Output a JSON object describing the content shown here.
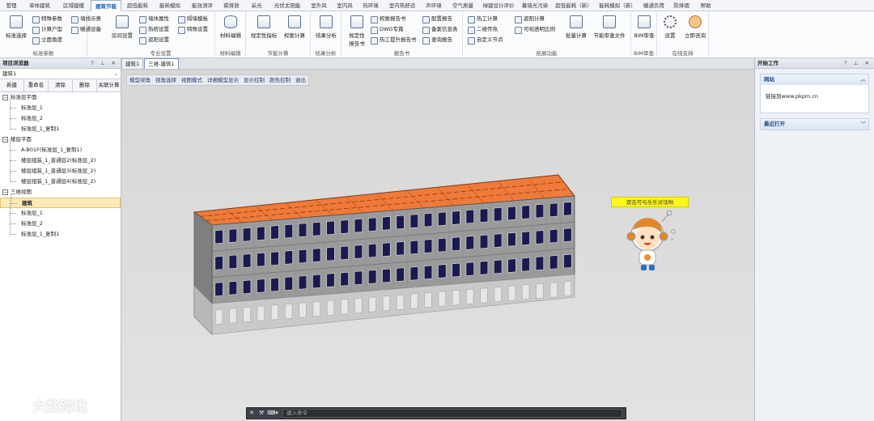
{
  "menu_tabs": [
    "管理",
    "单体建筑",
    "区域建模",
    "建筑节能",
    "超低能耗",
    "能耗模拟",
    "能效测评",
    "碳排放",
    "采光",
    "光伏太阳能",
    "室外风",
    "室内风",
    "热环境",
    "室内热舒适",
    "声环境",
    "空气质量",
    "绿建设计评价",
    "幕墙光污染",
    "超低能耗（新）",
    "能耗模拟（新）",
    "暖通负荷",
    "防排烟",
    "帮助"
  ],
  "active_menu_tab": "建筑节能",
  "ribbon": {
    "groups": {
      "standard_params": "标准参数",
      "pro_settings": "专业设置",
      "material_edit": "材料编辑",
      "energy_calc": "节能计算",
      "result_analysis": "结果分析",
      "report_book": "报告书",
      "expand_features": "拓展功能",
      "bim_review": "BIM审查",
      "online_support": "在线支持"
    },
    "buttons": {
      "standard_select": "标准选择",
      "special_params": "特殊参数",
      "calc_type": "计算户型",
      "orientation": "立面角度",
      "wall_display": "墙线示意",
      "hvac_device": "暖通设备",
      "room_settings": "房间设置",
      "wall_attr": "墙体属性",
      "thermal_bridge": "热桥设置",
      "shading": "遮阳设置",
      "partition_wall": "隔墙模板",
      "special_settings": "特殊设置",
      "material_edit": "材料编辑",
      "compliance_index": "规定性指标",
      "tradeoff_calc": "权衡计算",
      "result_analysis": "结果分析",
      "compliance_report": "规定性\n报告书",
      "tradeoff_report": "权衡报告书",
      "dwg_report": "DWG专篇",
      "thermal_report": "热工提升报告书",
      "config_report": "配置报告",
      "record_info": "备案信息表",
      "query_report": "查询报告",
      "thermal_calc": "热工计算",
      "2d_heat": "二维传热",
      "custom_node": "自定义节点",
      "shade_calc": "遮阳计算",
      "visible_ratio": "可视透明比例",
      "batch_calc": "批量计算",
      "review_file": "节能审查文件",
      "bim_review": "BIM审查",
      "settings": "设置",
      "consult": "立即咨询"
    }
  },
  "left_panel": {
    "title": "项目浏览器",
    "header_icons": "? ⊥ ✕",
    "dropdown_value": "建筑1",
    "toolbar": [
      "新建",
      "重命名",
      "清除",
      "删除",
      "关联计算"
    ],
    "tree": [
      {
        "label": "标准层平面",
        "children": [
          "标准层_1",
          "标准层_2",
          "标准层_1_复制1"
        ]
      },
      {
        "label": "楼层平面",
        "children": [
          "A-B01F(标准层_1_复制1)",
          "楼层组装_1_普通层2(标准层_2)",
          "楼层组装_1_普通层3(标准层_2)",
          "楼层组装_1_普通层4(标准层_2)"
        ]
      },
      {
        "label": "三维视图",
        "children": [
          "建筑",
          "标准层_1",
          "标准层_2",
          "标准层_1_复制1"
        ],
        "selected": "建筑"
      }
    ]
  },
  "doc_tabs": [
    "建筑1",
    "三维-建筑1"
  ],
  "active_doc_tab": "三维-建筑1",
  "view_toolbar": [
    "模型视角",
    "视角选择",
    "视图模式",
    "详细模型显示",
    "显示控制",
    "颜色控制",
    "退出"
  ],
  "hint_bubble": "双击可与乐乐对话哟",
  "cmdline": {
    "placeholder": "键入命令",
    "prefix": "⌨▾"
  },
  "right_panel": {
    "title": "开始工作",
    "header_icons": "? ⊥ ✕",
    "section_site": "网站",
    "site_link": "链接到www.pkpm.cn",
    "section_recent": "最近打开"
  },
  "watermark": "大数跨境",
  "colors": {
    "roof": "#f07a3a",
    "wall": "#9a9a9a",
    "ground_floor": "#c9c9c9",
    "window": "#1a1a50",
    "accent": "#1d5fb8"
  }
}
